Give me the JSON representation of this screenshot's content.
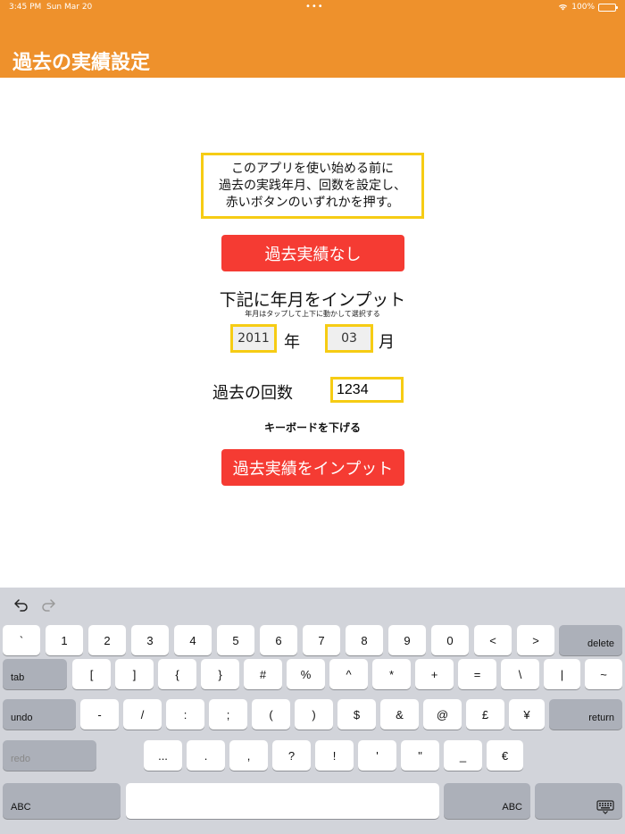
{
  "status_bar": {
    "time": "3:45 PM",
    "date": "Sun Mar 20",
    "multitask": "•••",
    "battery": "100%"
  },
  "header": {
    "title": "過去の実績設定"
  },
  "notice": {
    "lines": [
      "このアプリを使い始める前に",
      "過去の実践年月、回数を設定し、",
      "赤いボタンのいずれかを押す。"
    ]
  },
  "buttons": {
    "no_history": "過去実績なし",
    "input_history": "過去実績をインプット",
    "dismiss_keyboard": "キーボードを下げる"
  },
  "date_input": {
    "heading": "下記に年月をインプット",
    "hint": "年月はタップして上下に動かして選択する",
    "year_value": "2011",
    "year_unit": "年",
    "month_value": "03",
    "month_unit": "月"
  },
  "count_input": {
    "label": "過去の回数",
    "value": "1234"
  },
  "keyboard": {
    "row1": [
      "`",
      "1",
      "2",
      "3",
      "4",
      "5",
      "6",
      "7",
      "8",
      "9",
      "0",
      "<",
      ">"
    ],
    "row1_end": "delete",
    "row2_start": "tab",
    "row2": [
      "[",
      "]",
      "{",
      "}",
      "#",
      "%",
      "^",
      "*",
      "+",
      "=",
      "\\",
      "|",
      "~"
    ],
    "row3_start": "undo",
    "row3": [
      "-",
      "/",
      ":",
      ";",
      "(",
      ")",
      "$",
      "&",
      "@",
      "£",
      "¥"
    ],
    "row3_end": "return",
    "row4_start": "redo",
    "row4": [
      "...",
      ".",
      ",",
      "?",
      "!",
      "'",
      "\"",
      "_",
      "€"
    ],
    "row5_start": "ABC",
    "row5_end": "ABC"
  }
}
